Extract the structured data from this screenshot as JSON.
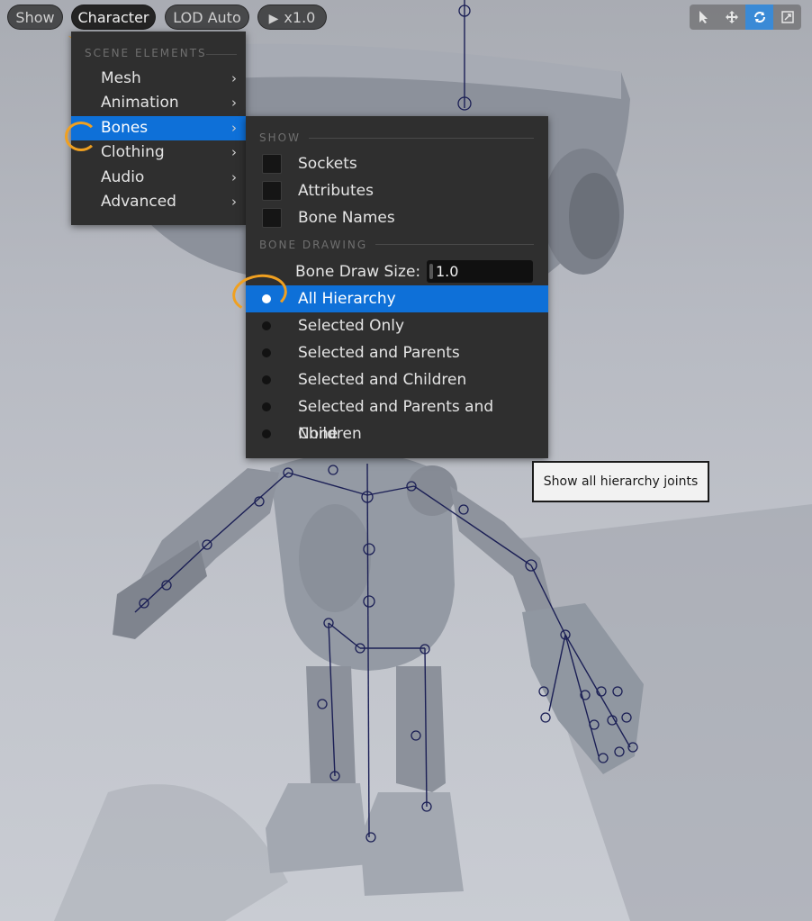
{
  "toolbar": {
    "show_label": "Show",
    "character_label": "Character",
    "lod_label": "LOD Auto",
    "play_icon": "play-icon",
    "speed_label": "x1.0",
    "viewport_tools": [
      "select-arrow-icon",
      "move-icon",
      "rotate-icon",
      "scale-icon"
    ]
  },
  "character_menu": {
    "section_title": "SCENE ELEMENTS",
    "items": [
      {
        "label": "Mesh",
        "has_submenu": true
      },
      {
        "label": "Animation",
        "has_submenu": true
      },
      {
        "label": "Bones",
        "has_submenu": true,
        "selected": true
      },
      {
        "label": "Clothing",
        "has_submenu": true
      },
      {
        "label": "Audio",
        "has_submenu": true
      },
      {
        "label": "Advanced",
        "has_submenu": true
      }
    ],
    "arrow_glyph": "›"
  },
  "bones_menu": {
    "show_section": "SHOW",
    "show_items": [
      {
        "label": "Sockets",
        "checked": false
      },
      {
        "label": "Attributes",
        "checked": false
      },
      {
        "label": "Bone Names",
        "checked": false
      }
    ],
    "drawing_section": "BONE DRAWING",
    "draw_size_label": "Bone Draw Size:",
    "draw_size_value": "1.0",
    "draw_options": [
      {
        "label": "All Hierarchy",
        "selected": true
      },
      {
        "label": "Selected Only",
        "selected": false
      },
      {
        "label": "Selected and Parents",
        "selected": false
      },
      {
        "label": "Selected and Children",
        "selected": false
      },
      {
        "label": "Selected and Parents and Children",
        "selected": false
      },
      {
        "label": "None",
        "selected": false
      }
    ]
  },
  "tooltip": {
    "text": "Show all hierarchy joints"
  },
  "colors": {
    "accent": "#0e70d8",
    "annotation": "#f0a020",
    "menu_bg": "#2f2f2f",
    "skeleton": "#1b1f55"
  }
}
